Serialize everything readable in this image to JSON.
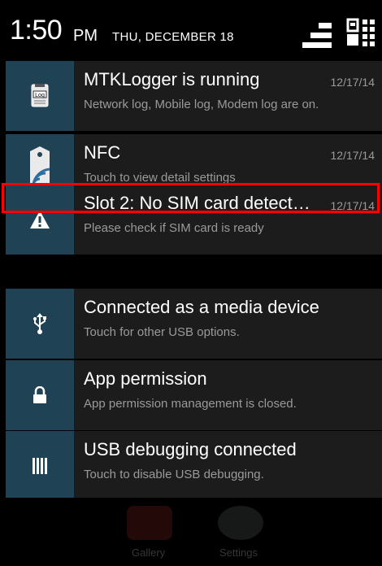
{
  "status": {
    "time": "1:50",
    "ampm": "PM",
    "date": "THU, DECEMBER 18"
  },
  "notifications": [
    {
      "title": "MTKLogger is running",
      "subtitle": "Network log, Mobile log, Modem log are on.",
      "time": "12/17/14",
      "icon": "log-icon"
    },
    {
      "title": "NFC",
      "subtitle": "Touch to view detail settings",
      "time": "12/17/14",
      "icon": "nfc-icon"
    },
    {
      "title": "Slot 2: No SIM card detect…",
      "subtitle": "Please check if SIM card is ready",
      "time": "12/17/14",
      "icon": "warning-icon"
    },
    {
      "title": "Connected as a media device",
      "subtitle": "Touch for other USB options.",
      "time": "",
      "icon": "usb-icon"
    },
    {
      "title": "App permission",
      "subtitle": "App permission management is closed.",
      "time": "",
      "icon": "lock-icon"
    },
    {
      "title": "USB debugging connected",
      "subtitle": "Touch to disable USB debugging.",
      "time": "",
      "icon": "debug-icon"
    }
  ],
  "background_apps": [
    {
      "label": "Gallery"
    },
    {
      "label": "Settings"
    }
  ],
  "colors": {
    "icon_box": "#1f4255",
    "card": "#1c1c1c",
    "highlight": "#ff0000"
  }
}
